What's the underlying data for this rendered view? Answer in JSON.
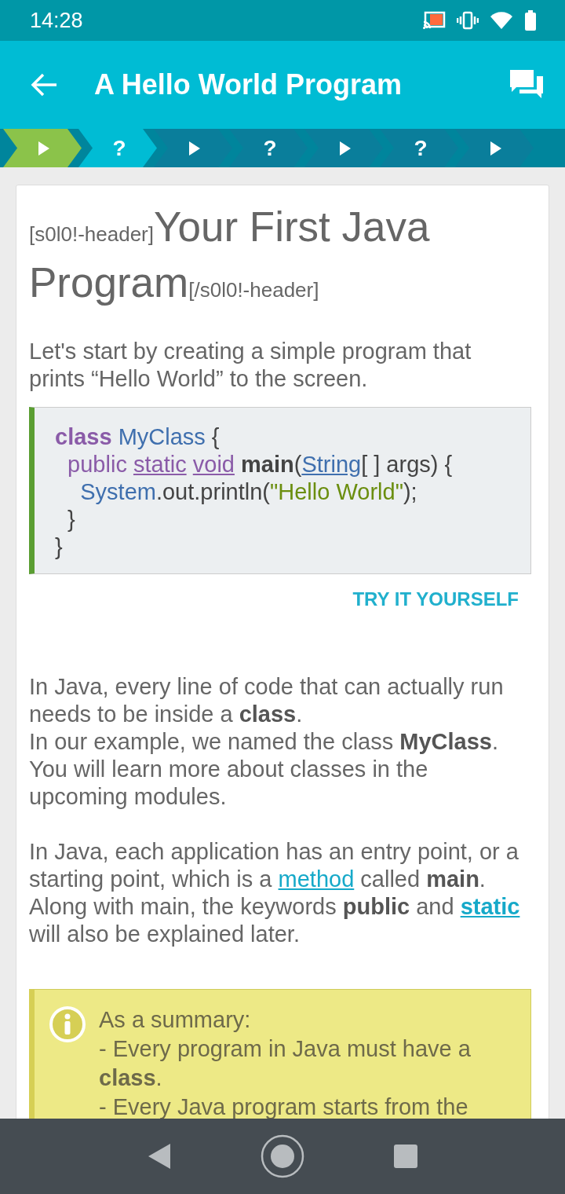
{
  "status_bar": {
    "time": "14:28"
  },
  "app_bar": {
    "title": "A Hello World Program"
  },
  "steps": [
    {
      "kind": "lesson",
      "selected": true,
      "unlocked": true
    },
    {
      "kind": "quiz",
      "label": "?",
      "selected": false,
      "unlocked": true
    },
    {
      "kind": "lesson",
      "selected": false,
      "unlocked": false
    },
    {
      "kind": "quiz",
      "label": "?",
      "selected": false,
      "unlocked": false
    },
    {
      "kind": "lesson",
      "selected": false,
      "unlocked": false
    },
    {
      "kind": "quiz",
      "label": "?",
      "selected": false,
      "unlocked": false
    },
    {
      "kind": "lesson",
      "selected": false,
      "unlocked": false
    }
  ],
  "lesson": {
    "header_open": "[s0l0!-header]",
    "title": "Your First Java Program",
    "header_close": "[/s0l0!-header]",
    "intro": "Let's start by creating a simple program that prints “Hello World” to the screen.",
    "code": [
      {
        "tokens": [
          {
            "text": "class",
            "kind": "keyword-bold"
          },
          {
            "text": " MyClass",
            "kind": "type"
          },
          {
            "text": " {",
            "kind": "plain"
          }
        ]
      },
      {
        "tokens": [
          {
            "text": "  public ",
            "kind": "keyword"
          },
          {
            "text": "static",
            "kind": "keyword-link"
          },
          {
            "text": "void",
            "kind": "keyword-link",
            "space_before": true
          },
          {
            "text": " main",
            "kind": "bold"
          },
          {
            "text": "(",
            "kind": "plain"
          },
          {
            "text": "String",
            "kind": "type-link"
          },
          {
            "text": "[ ] args) {",
            "kind": "plain"
          }
        ]
      },
      {
        "tokens": [
          {
            "text": "    System",
            "kind": "type"
          },
          {
            "text": ".out.println(",
            "kind": "plain"
          },
          {
            "text": "\"Hello World\"",
            "kind": "string"
          },
          {
            "text": ");",
            "kind": "plain"
          }
        ]
      },
      {
        "tokens": [
          {
            "text": "  }",
            "kind": "plain"
          }
        ]
      },
      {
        "tokens": [
          {
            "text": "}",
            "kind": "plain"
          }
        ]
      }
    ],
    "try_button": "TRY IT YOURSELF",
    "paragraphs": [
      [
        {
          "text": "In Java, every line of code that can actually run needs to be inside a ",
          "kind": "text"
        },
        {
          "text": "class",
          "kind": "bold"
        },
        {
          "text": ".",
          "kind": "text"
        }
      ],
      [
        {
          "text": "In our example, we named the class ",
          "kind": "text"
        },
        {
          "text": "MyClass",
          "kind": "bold"
        },
        {
          "text": ". You will learn more about classes in the upcoming modules.",
          "kind": "text"
        }
      ],
      [
        {
          "text": "In Java, each application has an entry point, or a starting point, which is a ",
          "kind": "text"
        },
        {
          "text": "method",
          "kind": "link"
        },
        {
          "text": " called ",
          "kind": "text"
        },
        {
          "text": "main",
          "kind": "bold"
        },
        {
          "text": ". Along with main, the keywords ",
          "kind": "text"
        },
        {
          "text": "public",
          "kind": "bold"
        },
        {
          "text": " and ",
          "kind": "text"
        },
        {
          "text": "static",
          "kind": "bold-link"
        },
        {
          "text": " will also be explained later.",
          "kind": "text"
        }
      ]
    ],
    "summary": [
      "As a summary:",
      "- Every program in Java must have a **class**.",
      "- Every Java program starts from the"
    ]
  }
}
